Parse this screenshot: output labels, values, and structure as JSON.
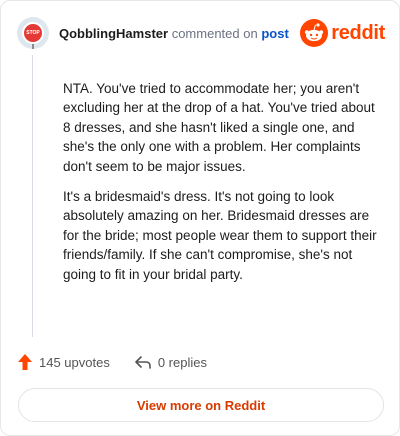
{
  "header": {
    "username": "QobblingHamster",
    "verb": "commented on",
    "post_link": "post",
    "avatar_sign_text": "STOP",
    "brand_word": "reddit"
  },
  "comment": {
    "paragraphs": [
      "NTA. You've tried to accommodate her; you aren't excluding her at the drop of a hat. You've tried about 8 dresses, and she hasn't liked a single one, and she's the only one with a problem. Her complaints don't seem to be major issues.",
      "It's a bridesmaid's dress. It's not going to look absolutely amazing on her. Bridesmaid dresses are for the bride; most people wear them to support their friends/family. If she can't compromise, she's not going to fit in your bridal party."
    ]
  },
  "actions": {
    "upvotes_label": "145 upvotes",
    "replies_label": "0 replies"
  },
  "footer": {
    "view_more_label": "View more on Reddit"
  },
  "colors": {
    "brand": "#ff4500",
    "link": "#0a55c5",
    "upvote": "#ff4500",
    "view_more_text": "#d93a00"
  },
  "icons": [
    "stop-sign-avatar-icon",
    "reddit-snoo-icon",
    "upvote-arrow-icon",
    "reply-arrow-icon"
  ]
}
